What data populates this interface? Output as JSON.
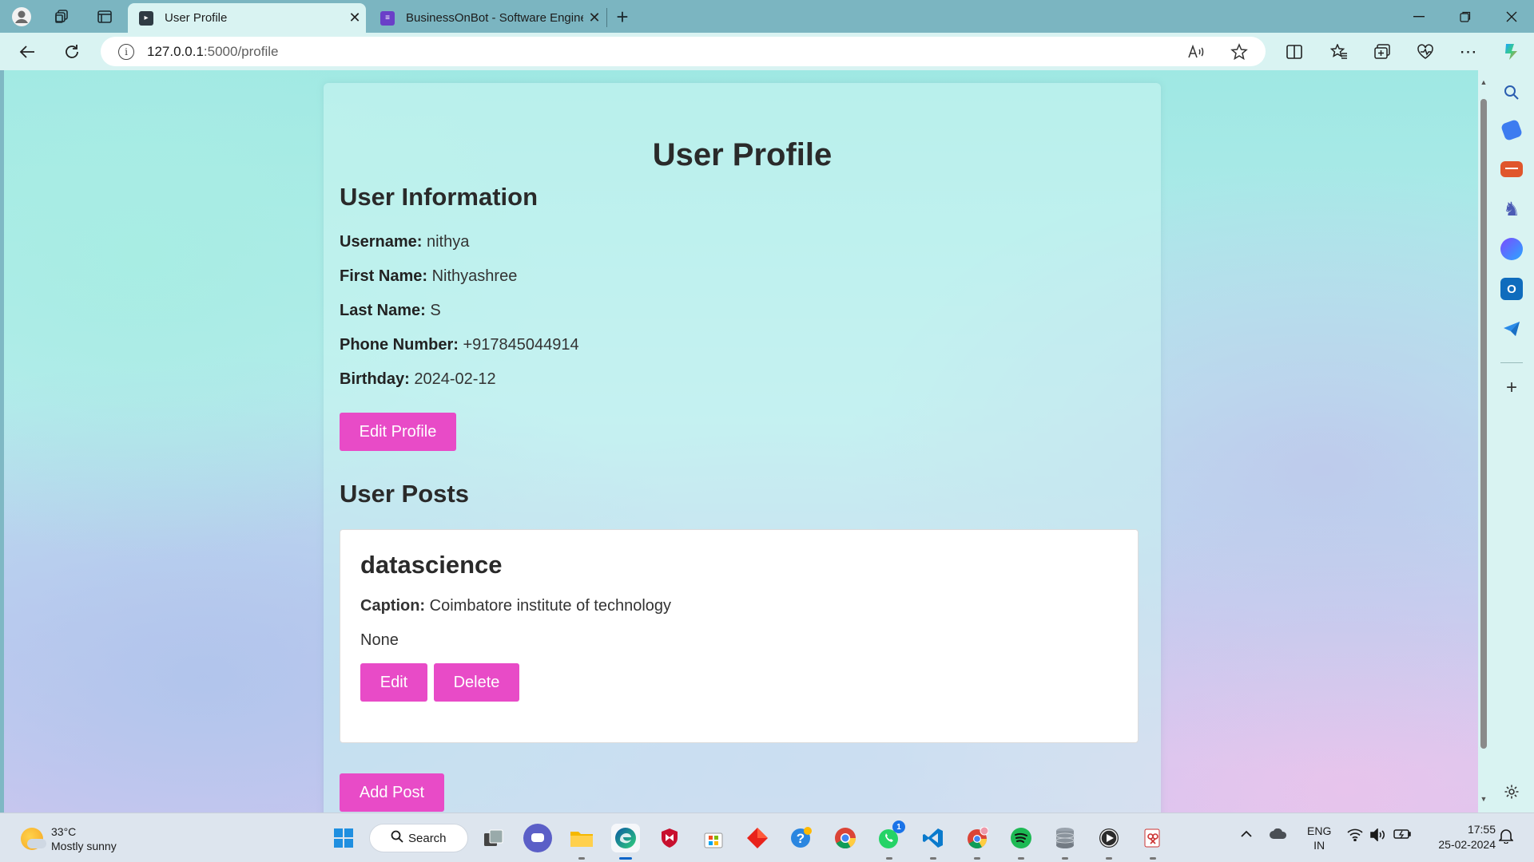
{
  "browser": {
    "tabs": [
      {
        "title": "User Profile",
        "active": true
      },
      {
        "title": "BusinessOnBot - Software Engine",
        "active": false
      }
    ],
    "new_tab_label": "+",
    "url_host": "127.0.0.1",
    "url_path": ":5000/profile"
  },
  "page": {
    "title": "User Profile",
    "info_heading": "User Information",
    "fields": [
      {
        "label": "Username:",
        "value": "nithya"
      },
      {
        "label": "First Name:",
        "value": "Nithyashree"
      },
      {
        "label": "Last Name:",
        "value": "S"
      },
      {
        "label": "Phone Number:",
        "value": "+917845044914"
      },
      {
        "label": "Birthday:",
        "value": "2024-02-12"
      }
    ],
    "edit_profile_label": "Edit Profile",
    "posts_heading": "User Posts",
    "post": {
      "title": "datascience",
      "caption_label": "Caption:",
      "caption_value": "Coimbatore institute of technology",
      "extra": "None",
      "edit_label": "Edit",
      "delete_label": "Delete"
    },
    "add_post_label": "Add Post"
  },
  "taskbar": {
    "temperature": "33°C",
    "weather": "Mostly sunny",
    "search_label": "Search",
    "lang_top": "ENG",
    "lang_bottom": "IN",
    "time": "17:55",
    "date": "25-02-2024",
    "whatsapp_badge": "1"
  },
  "colors": {
    "accent_button": "#e84bc7",
    "tab_strip": "#7bb5c1",
    "toolbar": "#d9f3f2"
  }
}
